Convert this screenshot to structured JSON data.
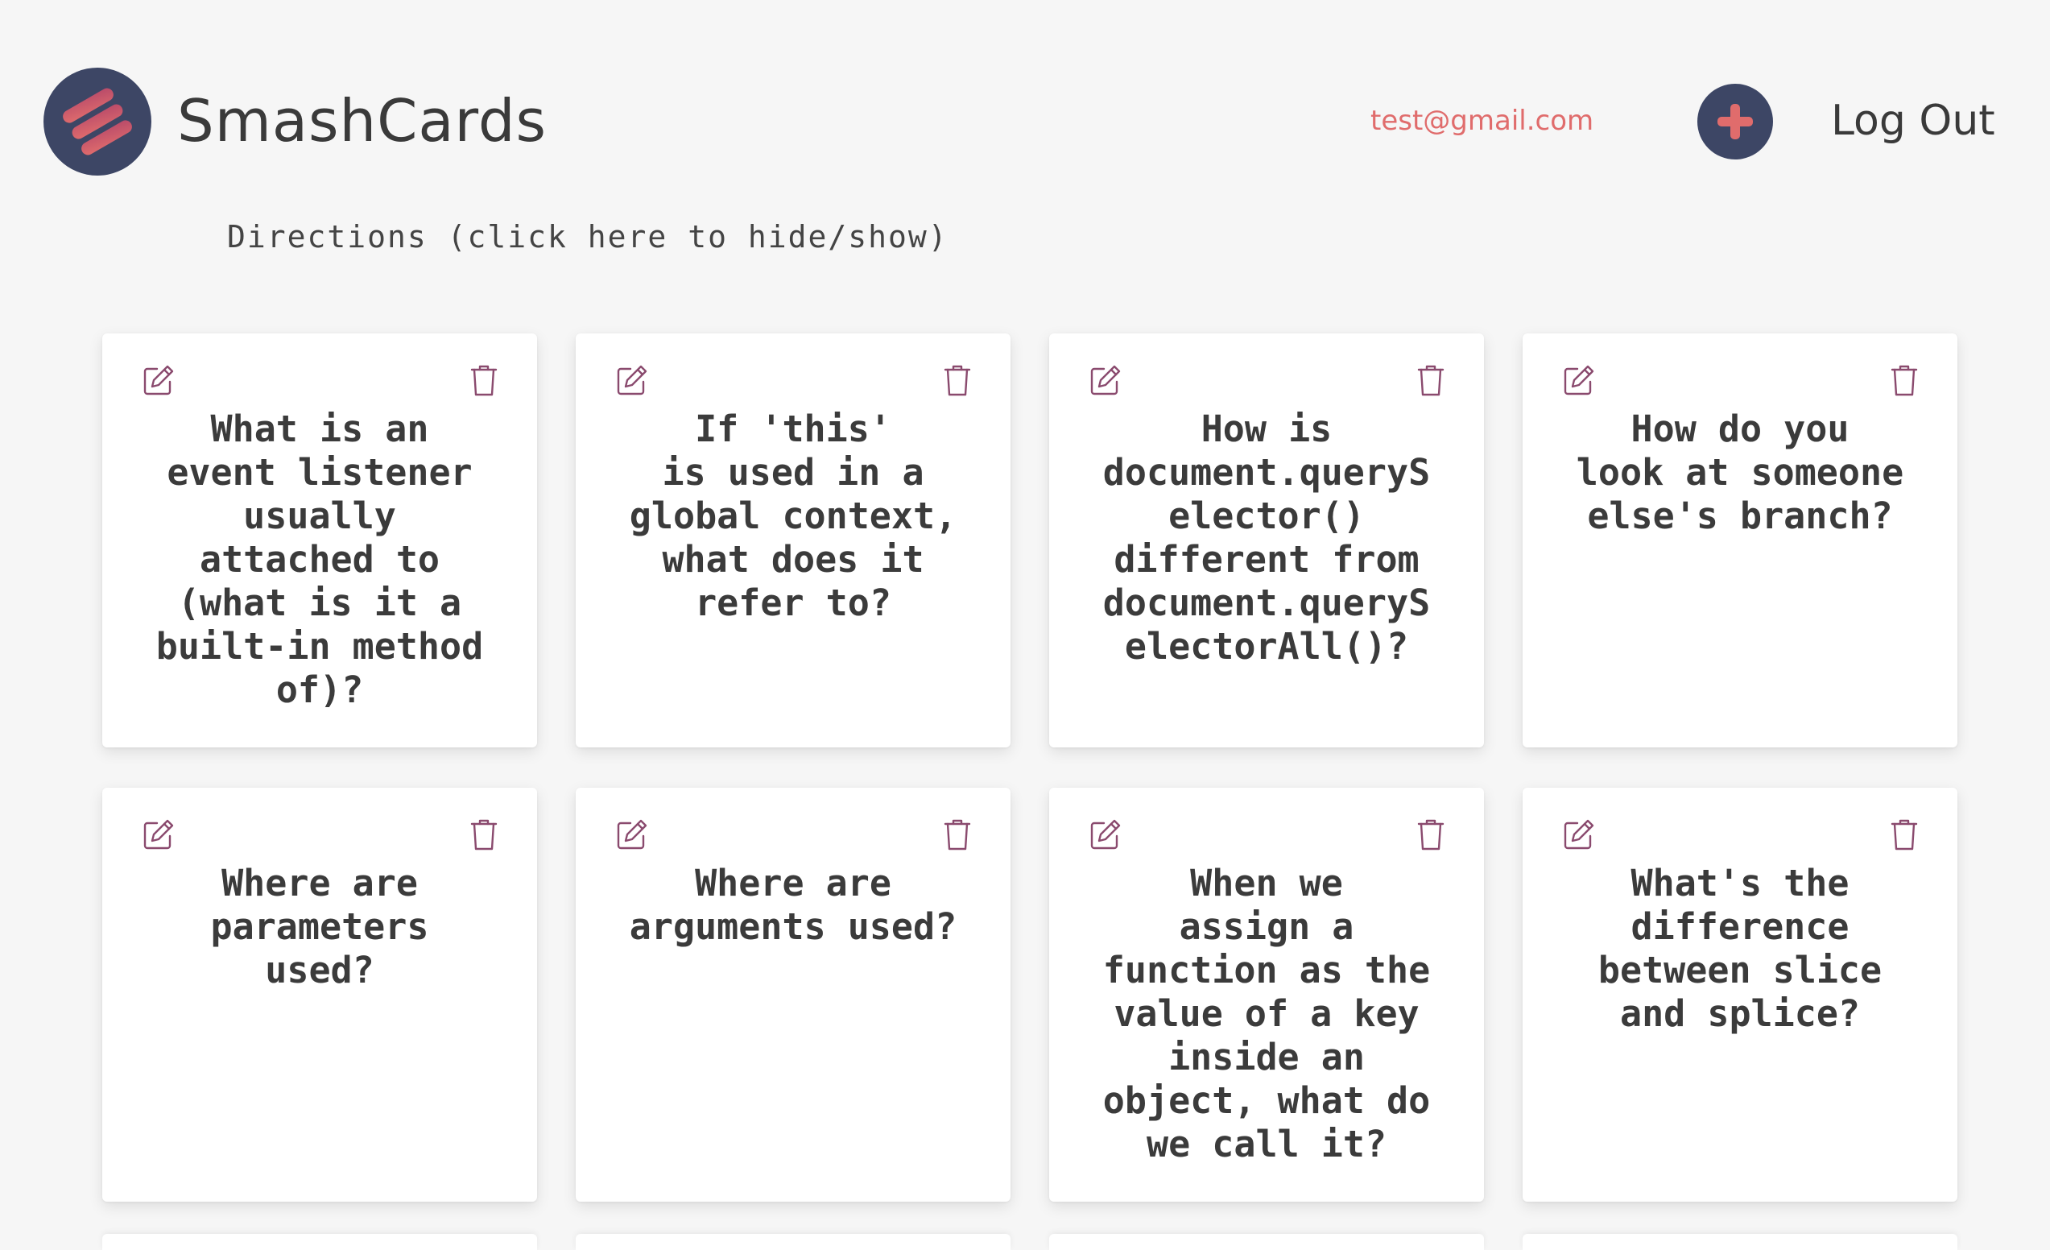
{
  "header": {
    "brand": "SmashCards",
    "logo_icon": "smashcards-logo-icon",
    "email": "test@gmail.com",
    "add_icon": "plus-icon",
    "logout_label": "Log Out"
  },
  "directions": {
    "label": "Directions (click here to hide/show)"
  },
  "colors": {
    "accent": "#e06c6c",
    "navy": "#3d4665",
    "icon": "#8a4a6e",
    "background": "#f6f6f6"
  },
  "cards": [
    {
      "question": "What is an\nevent listener\nusually\nattached to\n(what is it a\nbuilt-in method\nof)?"
    },
    {
      "question": "If 'this'\nis used in a\nglobal context,\nwhat does it\nrefer to?"
    },
    {
      "question": "How is\ndocument.queryS\nelector()\ndifferent from\ndocument.queryS\nelectorAll()?"
    },
    {
      "question": "How do you\nlook at someone\nelse's branch?"
    },
    {
      "question": "Where are\nparameters\nused?"
    },
    {
      "question": "Where are\narguments used?"
    },
    {
      "question": "When we\nassign a\nfunction as the\nvalue of a key\ninside an\nobject, what do\nwe call it?"
    },
    {
      "question": "What's the\ndifference\nbetween slice\nand splice?"
    }
  ],
  "card_icons": {
    "edit": "edit-icon",
    "delete": "trash-icon"
  }
}
